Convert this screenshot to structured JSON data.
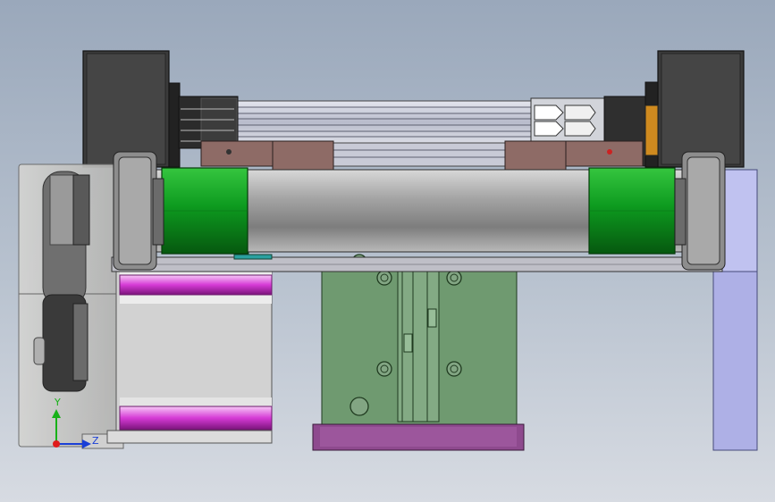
{
  "viewport": {
    "colors": {
      "bg_top": "#9aa8bb",
      "bg_bottom": "#d7dbe2",
      "motor_black": "#3a3a3a",
      "roller_green": "#0d9a1f",
      "shaft_gray": "#a8a8a8",
      "slide_green": "#6f9a70",
      "base_purple": "#8e4a8e",
      "magenta": "#d53ad5",
      "bracket_lavender": "#aeb0e6",
      "bracket_brown": "#8e6b66",
      "housing_gray": "#c9c9c9"
    }
  },
  "triad": {
    "y_label": "Y",
    "z_label": "Z",
    "x_color": "#e01b1b",
    "y_color": "#18b118",
    "z_color": "#1a3fd6"
  }
}
